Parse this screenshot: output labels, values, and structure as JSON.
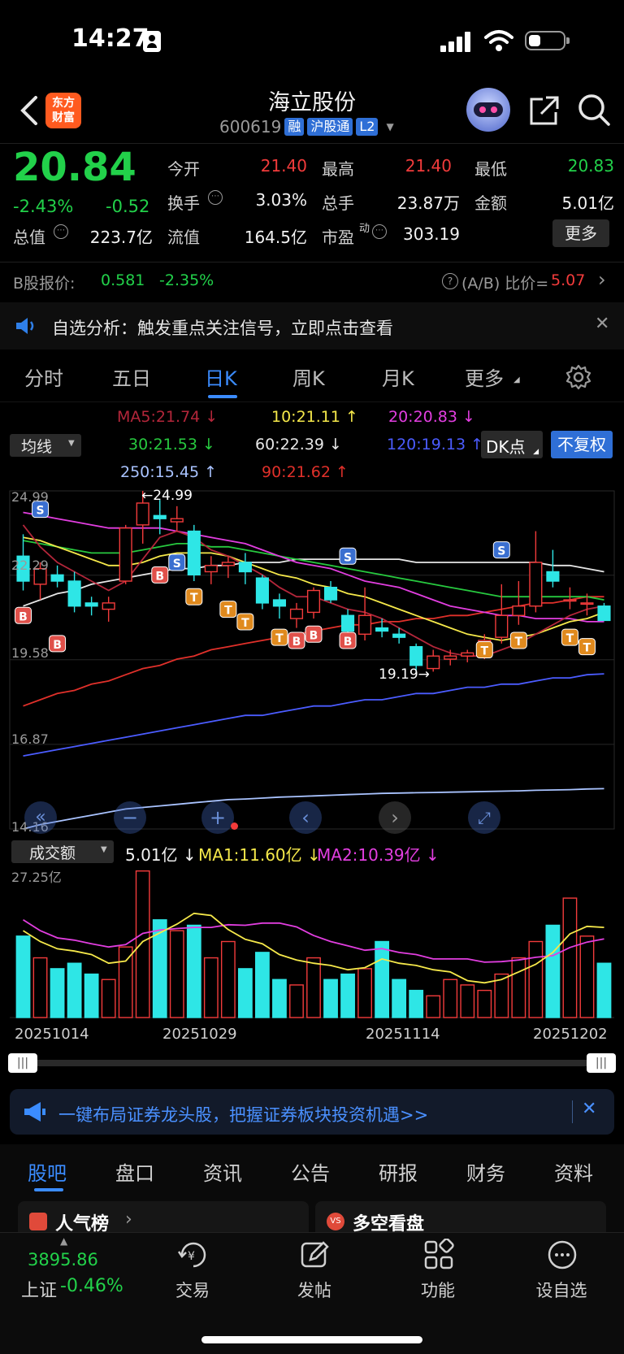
{
  "status_bar": {
    "time": "14:27"
  },
  "header": {
    "back_label": "‹",
    "logo_line1": "东方",
    "logo_line2": "财富",
    "title": "海立股份",
    "code": "600619",
    "badges": [
      "融",
      "沪股通",
      "L2"
    ]
  },
  "quote": {
    "price": "20.84",
    "change_pct": "-2.43%",
    "change": "-0.52",
    "fields": {
      "open_label": "今开",
      "open": "21.40",
      "high_label": "最高",
      "high": "21.40",
      "low_label": "最低",
      "low": "20.83",
      "turnover_label": "换手",
      "turnover": "3.03%",
      "volume_label": "总手",
      "volume": "23.87万",
      "amount_label": "金额",
      "amount": "5.01亿",
      "mcap_label": "总值",
      "mcap": "223.7亿",
      "float_label": "流值",
      "float": "164.5亿",
      "pe_label": "市盈",
      "pe_sup": "动",
      "pe": "303.19"
    },
    "more_label": "更多"
  },
  "b_share": {
    "label": "B股报价:",
    "price": "0.581",
    "pct": "-2.35%",
    "ratio_label": "(A/B) 比价=",
    "ratio": "5.07"
  },
  "notice": {
    "text": "自选分析：触发重点关注信号，立即点击查看"
  },
  "tabs": {
    "items": [
      "分时",
      "五日",
      "日K",
      "周K",
      "月K",
      "更多"
    ],
    "active": "日K"
  },
  "ma_legend": {
    "selector": "均线",
    "ma5": "MA5:21.74",
    "ma10": "10:21.11",
    "ma20": "20:20.83",
    "ma30": "30:21.53",
    "ma60": "60:22.39",
    "ma120": "120:19.13",
    "ma250": "250:15.45",
    "ma90": "90:21.62",
    "dk_label": "DK点",
    "adjust_label": "不复权"
  },
  "chart_data": {
    "type": "candlestick",
    "y_axis_labels": [
      "24.99",
      "22.29",
      "19.58",
      "16.87",
      "14.16"
    ],
    "annotations": {
      "high": "←24.99",
      "low": "19.19→"
    },
    "marker_labels": {
      "buy": "B",
      "sell": "S",
      "t": "T"
    },
    "volume_panel": {
      "selector": "成交额",
      "value": "5.01亿",
      "ma1": "MA1:11.60亿",
      "ma2": "MA2:10.39亿",
      "max_label": "27.25亿",
      "x_labels": [
        "20251014",
        "20251029",
        "20251114",
        "20251202"
      ]
    },
    "candles": [
      {
        "o": 22.9,
        "h": 23.6,
        "l": 21.8,
        "c": 22.1
      },
      {
        "o": 22.0,
        "h": 22.7,
        "l": 21.5,
        "c": 22.5
      },
      {
        "o": 22.3,
        "h": 22.6,
        "l": 21.9,
        "c": 22.1
      },
      {
        "o": 22.1,
        "h": 22.4,
        "l": 21.1,
        "c": 21.3
      },
      {
        "o": 21.4,
        "h": 21.6,
        "l": 21.0,
        "c": 21.3
      },
      {
        "o": 21.2,
        "h": 21.6,
        "l": 20.8,
        "c": 21.4
      },
      {
        "o": 22.1,
        "h": 23.9,
        "l": 22.0,
        "c": 23.8
      },
      {
        "o": 23.9,
        "h": 24.99,
        "l": 23.3,
        "c": 24.6
      },
      {
        "o": 24.2,
        "h": 24.7,
        "l": 23.6,
        "c": 24.1
      },
      {
        "o": 24.0,
        "h": 24.5,
        "l": 23.7,
        "c": 24.1
      },
      {
        "o": 23.7,
        "h": 23.9,
        "l": 22.1,
        "c": 22.3
      },
      {
        "o": 22.4,
        "h": 22.9,
        "l": 22.0,
        "c": 22.6
      },
      {
        "o": 22.6,
        "h": 22.9,
        "l": 22.2,
        "c": 22.7
      },
      {
        "o": 22.7,
        "h": 23.0,
        "l": 22.0,
        "c": 22.4
      },
      {
        "o": 22.2,
        "h": 22.3,
        "l": 21.2,
        "c": 21.4
      },
      {
        "o": 21.5,
        "h": 21.7,
        "l": 20.9,
        "c": 21.3
      },
      {
        "o": 20.9,
        "h": 21.4,
        "l": 20.6,
        "c": 21.2
      },
      {
        "o": 21.1,
        "h": 21.9,
        "l": 20.9,
        "c": 21.8
      },
      {
        "o": 21.9,
        "h": 22.1,
        "l": 21.4,
        "c": 21.5
      },
      {
        "o": 21.0,
        "h": 21.2,
        "l": 20.3,
        "c": 20.5
      },
      {
        "o": 20.4,
        "h": 21.9,
        "l": 20.2,
        "c": 21.0
      },
      {
        "o": 20.6,
        "h": 20.9,
        "l": 20.3,
        "c": 20.5
      },
      {
        "o": 20.4,
        "h": 20.6,
        "l": 20.1,
        "c": 20.3
      },
      {
        "o": 20.0,
        "h": 20.1,
        "l": 19.19,
        "c": 19.4
      },
      {
        "o": 19.3,
        "h": 19.9,
        "l": 19.2,
        "c": 19.7
      },
      {
        "o": 19.6,
        "h": 19.9,
        "l": 19.4,
        "c": 19.7
      },
      {
        "o": 19.7,
        "h": 19.9,
        "l": 19.5,
        "c": 19.8
      },
      {
        "o": 19.8,
        "h": 20.4,
        "l": 19.6,
        "c": 20.2
      },
      {
        "o": 20.3,
        "h": 22.0,
        "l": 20.1,
        "c": 21.0
      },
      {
        "o": 21.0,
        "h": 22.1,
        "l": 20.7,
        "c": 21.3
      },
      {
        "o": 21.3,
        "h": 23.7,
        "l": 21.1,
        "c": 22.7
      },
      {
        "o": 22.4,
        "h": 23.1,
        "l": 21.9,
        "c": 22.1
      },
      {
        "o": 21.5,
        "h": 21.9,
        "l": 21.2,
        "c": 21.5
      },
      {
        "o": 21.4,
        "h": 21.7,
        "l": 21.0,
        "c": 21.4
      },
      {
        "o": 21.3,
        "h": 21.4,
        "l": 20.83,
        "c": 20.84
      }
    ],
    "volume": [
      15,
      11,
      9,
      10,
      8,
      7,
      13,
      27,
      18,
      16,
      17,
      11,
      14,
      9,
      12,
      7,
      6,
      11,
      7,
      8,
      9,
      14,
      7,
      5,
      4,
      7,
      6,
      5,
      8,
      11,
      14,
      17,
      22,
      15,
      10,
      8,
      6
    ],
    "ma_lines": {
      "ma5": [
        23.9,
        23.2,
        22.7,
        22.4,
        22.1,
        21.8,
        22.1,
        22.8,
        23.5,
        23.7,
        23.5,
        23.1,
        22.9,
        22.6,
        22.3,
        21.9,
        21.6,
        21.6,
        21.4,
        21.2,
        21.1,
        20.9,
        20.6,
        20.3,
        20.0,
        19.8,
        19.7,
        19.7,
        19.9,
        20.1,
        20.4,
        20.7,
        21.0,
        21.2,
        21.3
      ],
      "ma10": [
        23.5,
        23.4,
        23.2,
        23.0,
        22.8,
        22.6,
        22.6,
        22.7,
        22.9,
        23.0,
        23.0,
        23.0,
        22.9,
        22.7,
        22.5,
        22.3,
        22.2,
        22.0,
        21.9,
        21.7,
        21.6,
        21.4,
        21.2,
        21.0,
        20.8,
        20.6,
        20.4,
        20.3,
        20.2,
        20.3,
        20.4,
        20.6,
        20.8,
        20.9,
        21.1
      ],
      "ma30": [
        23.4,
        23.3,
        23.2,
        23.1,
        23.0,
        23.0,
        23.0,
        23.1,
        23.2,
        23.3,
        23.3,
        23.2,
        23.2,
        23.1,
        23.0,
        22.9,
        22.8,
        22.7,
        22.6,
        22.5,
        22.4,
        22.3,
        22.2,
        22.1,
        22.0,
        21.9,
        21.8,
        21.7,
        21.6,
        21.6,
        21.6,
        21.6,
        21.6,
        21.6,
        21.5
      ],
      "ma60": [
        21.3,
        21.5,
        21.7,
        21.8,
        22.0,
        22.1,
        22.2,
        22.3,
        22.4,
        22.5,
        22.5,
        22.6,
        22.6,
        22.7,
        22.7,
        22.7,
        22.8,
        22.8,
        22.8,
        22.8,
        22.8,
        22.8,
        22.8,
        22.7,
        22.7,
        22.7,
        22.7,
        22.7,
        22.7,
        22.7,
        22.7,
        22.6,
        22.6,
        22.5,
        22.4
      ],
      "ma90": [
        18.1,
        18.3,
        18.5,
        18.6,
        18.8,
        18.9,
        19.1,
        19.3,
        19.4,
        19.6,
        19.7,
        19.9,
        20.0,
        20.1,
        20.2,
        20.3,
        20.4,
        20.5,
        20.6,
        20.7,
        20.7,
        20.8,
        20.8,
        20.9,
        20.9,
        21.0,
        21.0,
        21.1,
        21.2,
        21.3,
        21.4,
        21.4,
        21.5,
        21.6,
        21.6
      ],
      "ma20": [
        24.3,
        24.2,
        24.1,
        24.0,
        23.9,
        23.8,
        23.8,
        23.8,
        23.8,
        23.7,
        23.6,
        23.5,
        23.4,
        23.3,
        23.1,
        22.9,
        22.7,
        22.6,
        22.5,
        22.3,
        22.1,
        22.0,
        21.9,
        21.7,
        21.5,
        21.3,
        21.2,
        21.1,
        21.0,
        21.0,
        20.9,
        20.9,
        20.9,
        20.8,
        20.8
      ],
      "ma120": [
        16.5,
        16.6,
        16.7,
        16.8,
        16.9,
        17.0,
        17.1,
        17.2,
        17.3,
        17.4,
        17.5,
        17.6,
        17.7,
        17.8,
        17.8,
        17.9,
        18.0,
        18.1,
        18.1,
        18.2,
        18.3,
        18.3,
        18.4,
        18.5,
        18.5,
        18.6,
        18.7,
        18.7,
        18.8,
        18.8,
        18.9,
        19.0,
        19.0,
        19.1,
        19.13
      ],
      "ma250": [
        14.16,
        14.3,
        14.4,
        14.5,
        14.6,
        14.7,
        14.8,
        14.85,
        14.9,
        14.95,
        15.0,
        15.05,
        15.1,
        15.12,
        15.15,
        15.18,
        15.2,
        15.22,
        15.24,
        15.26,
        15.28,
        15.3,
        15.31,
        15.32,
        15.33,
        15.34,
        15.35,
        15.36,
        15.37,
        15.38,
        15.4,
        15.41,
        15.42,
        15.44,
        15.45
      ]
    }
  },
  "ad_banner": {
    "text": "一键布局证券龙头股，把握证券板块投资机遇>>"
  },
  "bottom_tabs": {
    "items": [
      "股吧",
      "盘口",
      "资讯",
      "公告",
      "研报",
      "财务",
      "资料"
    ],
    "active": "股吧"
  },
  "cards": {
    "left": "人气榜",
    "right": "多空看盘"
  },
  "bottom_nav": {
    "index_value": "3895.86",
    "index_label": "上证",
    "index_pct": "-0.46%",
    "items": [
      "交易",
      "发帖",
      "功能",
      "设自选"
    ]
  }
}
